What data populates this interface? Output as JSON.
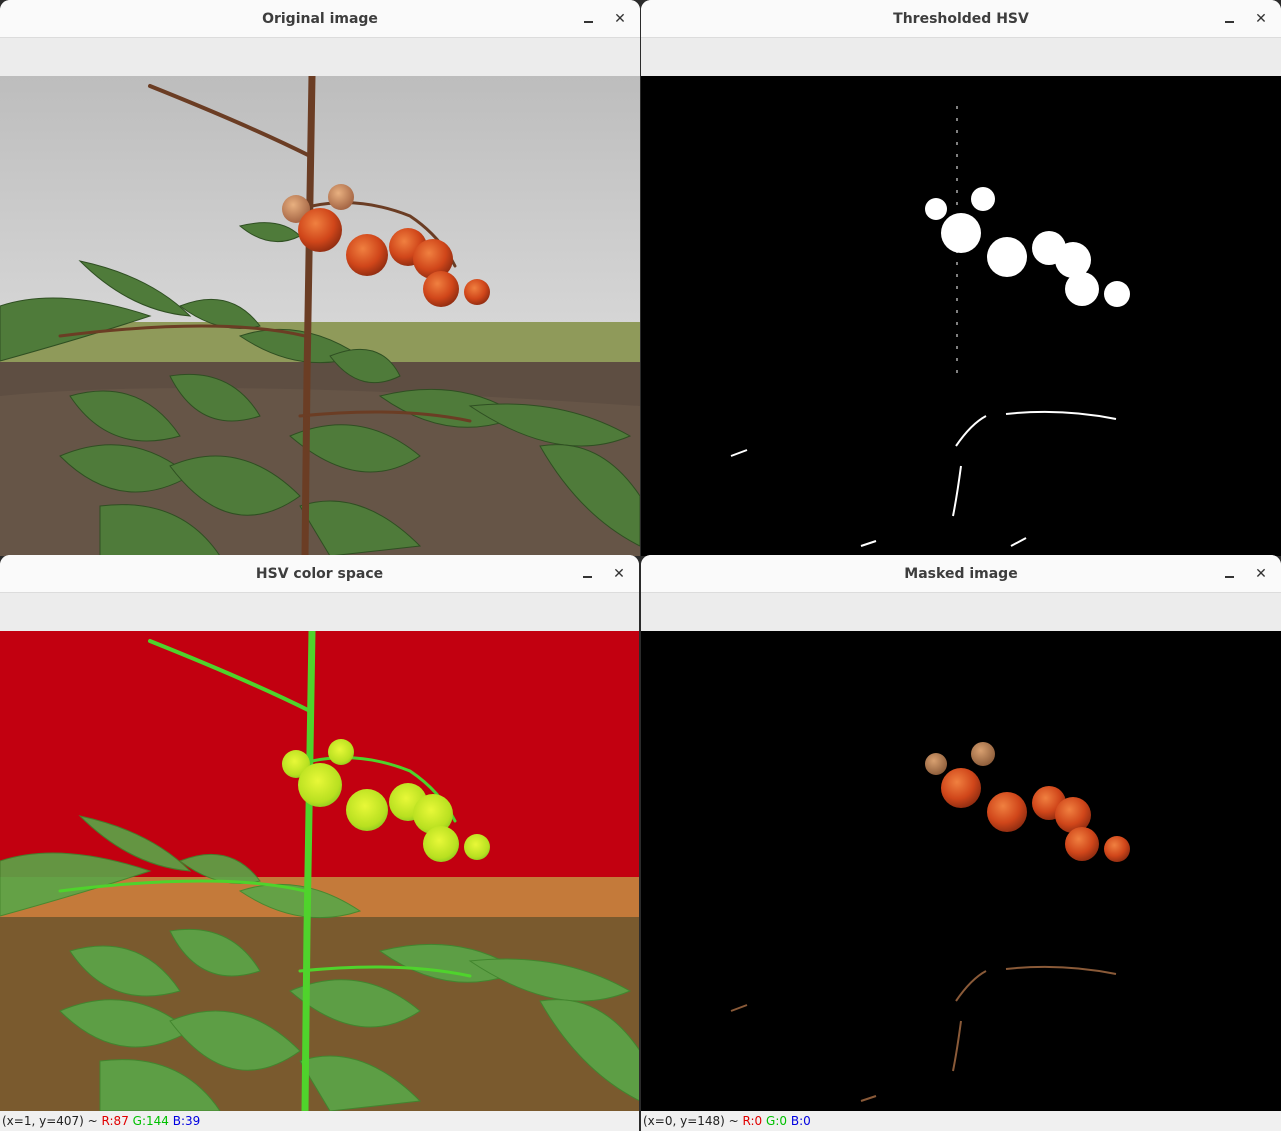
{
  "windows": {
    "original": {
      "title": "Original image"
    },
    "thresholded": {
      "title": "Thresholded HSV"
    },
    "hsv": {
      "title": "HSV color space",
      "status": {
        "coords": "(x=1, y=407) ~",
        "r": "R:87",
        "g": "G:144",
        "b": "B:39"
      }
    },
    "masked": {
      "title": "Masked image",
      "status": {
        "coords": "(x=0, y=148) ~",
        "r": "R:0",
        "g": "G:0",
        "b": "B:0"
      }
    }
  },
  "controls": {
    "minimize_symbol": "–",
    "close_symbol": "✕"
  },
  "colors": {
    "sky": "#c8c8c8",
    "ground": "#6a5a4d",
    "leaf": "#4e7a3a",
    "stem": "#6b3d24",
    "tomato": "#d9521f",
    "hsv_red": "#c4000e",
    "hsv_green": "#4fb72c",
    "hsv_yellow": "#d8ee1c"
  }
}
